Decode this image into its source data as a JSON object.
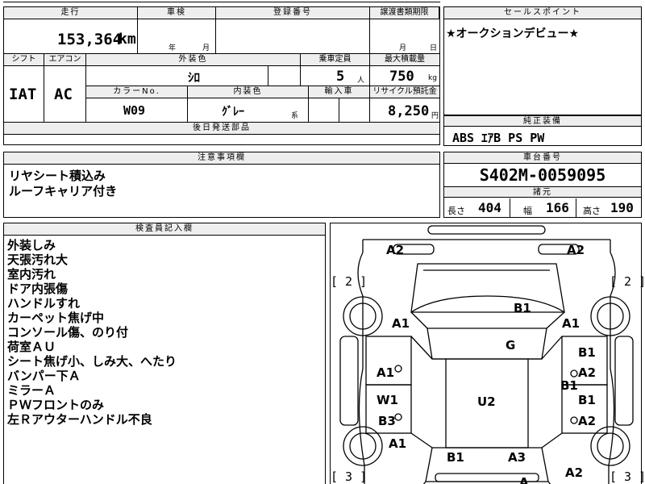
{
  "vehicle": {
    "mileage_label": "走行",
    "mileage_value": "153,364",
    "mileage_unit": "km",
    "inspection_label": "車検",
    "inspection_year": "年",
    "inspection_month": "月",
    "registration_label": "登録番号",
    "transfer_deadline_label": "譲渡書類期限",
    "transfer_month": "月",
    "transfer_day": "日",
    "shift_label": "シフト",
    "shift_value": "IAT",
    "aircon_label": "エアコン",
    "aircon_value": "AC",
    "exterior_color_label": "外装色",
    "exterior_color_value": "ｼﾛ",
    "color_no_label": "カラーNo.",
    "color_no_value": "W09",
    "interior_color_label": "内装色",
    "interior_color_value": "ｸﾞﾚｰ",
    "interior_color_suffix": "系",
    "capacity_label": "乗車定員",
    "capacity_value": "5",
    "capacity_unit": "人",
    "max_load_label": "最大積載量",
    "max_load_value": "750",
    "max_load_unit": "kg",
    "import_label": "輸入車",
    "recycle_label": "リサイクル預託金",
    "recycle_value": "8,250",
    "recycle_unit": "円",
    "later_parts_label": "後日発送部品"
  },
  "sales_point": {
    "label": "セールスポイント",
    "text": "★オークションデビュー★"
  },
  "equipment": {
    "label": "純正装備",
    "text": "ABS ｴｱB PS PW"
  },
  "caution": {
    "label": "注意事項欄",
    "lines": [
      "リヤシート積込み",
      "ルーフキャリア付き"
    ]
  },
  "chassis": {
    "label": "車台番号",
    "value": "S402M-0059095",
    "specs_label": "諸元",
    "length_label": "長さ",
    "length_value": "404",
    "width_label": "幅",
    "width_value": "166",
    "height_label": "高さ",
    "height_value": "190"
  },
  "inspector": {
    "label": "検査員記入欄",
    "lines": [
      "外装しみ",
      "天張汚れ大",
      "室内汚れ",
      "ドア内張傷",
      "ハンドルすれ",
      "カーペット焦げ中",
      "コンソール傷、のり付",
      "荷室ＡＵ",
      "シート焦げ小、しみ大、へたり",
      "バンパー下Ａ",
      "ミラーＡ",
      "ＰＷフロントのみ",
      "左Ｒアウターハンドル不良"
    ]
  },
  "diagram": {
    "labels": {
      "a2_top_left": "A2",
      "a2_top_right": "A2",
      "b1_roof": "B1",
      "a1_left_front": "A1",
      "a1_right_front": "A1",
      "g_windshield": "G",
      "a1_left_door": "A1",
      "b1_right_door1": "B1",
      "a2_right_door1": "A2",
      "b1_right_mid": "B1",
      "w1_left": "W1",
      "u2_center": "U2",
      "b1_right_door2": "B1",
      "b3_left": "B3",
      "a2_right_door2": "A2",
      "a1_left_rear": "A1",
      "b1_rear": "B1",
      "a3_rear": "A3",
      "a2_bottom_right": "A2",
      "a_bottom": "A"
    },
    "brackets": {
      "front_left": "[ 2 ]",
      "front_right": "[ 2 ]",
      "rear_left": "[ 3 ]",
      "rear_right": "[ 3 ]"
    }
  }
}
